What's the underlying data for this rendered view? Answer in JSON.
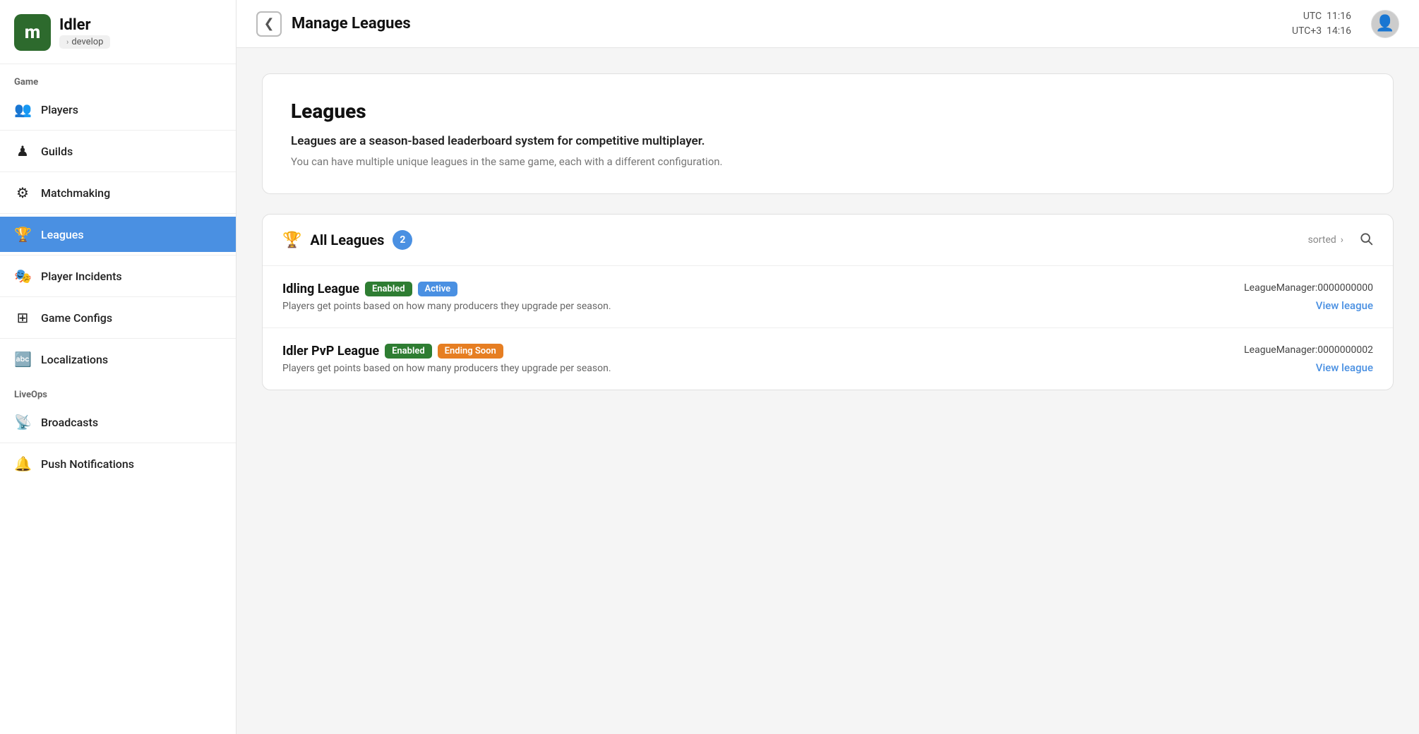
{
  "app": {
    "logo_letter": "m",
    "title": "Idler",
    "env": "develop"
  },
  "sidebar": {
    "game_label": "Game",
    "liveops_label": "LiveOps",
    "items_game": [
      {
        "id": "players",
        "label": "Players",
        "icon": "👥"
      },
      {
        "id": "guilds",
        "label": "Guilds",
        "icon": "♟"
      },
      {
        "id": "matchmaking",
        "label": "Matchmaking",
        "icon": "⚙"
      },
      {
        "id": "leagues",
        "label": "Leagues",
        "icon": "🏆",
        "active": true
      },
      {
        "id": "player-incidents",
        "label": "Player Incidents",
        "icon": "🎭"
      },
      {
        "id": "game-configs",
        "label": "Game Configs",
        "icon": "⊞"
      },
      {
        "id": "localizations",
        "label": "Localizations",
        "icon": "🔤"
      }
    ],
    "items_liveops": [
      {
        "id": "broadcasts",
        "label": "Broadcasts",
        "icon": "📡"
      },
      {
        "id": "push-notifications",
        "label": "Push Notifications",
        "icon": "🔔"
      }
    ]
  },
  "header": {
    "back_icon": "❮",
    "title": "Manage Leagues",
    "utc_label": "UTC",
    "utc_time": "11:16",
    "utcplus_label": "UTC+3",
    "utcplus_time": "14:16"
  },
  "info_card": {
    "title": "Leagues",
    "desc1": "Leagues are a season-based leaderboard system for competitive multiplayer.",
    "desc2": "You can have multiple unique leagues in the same game, each with a different configuration."
  },
  "leagues_section": {
    "icon": "🏆",
    "title": "All Leagues",
    "count": 2,
    "sorted_label": "sorted",
    "leagues": [
      {
        "name": "Idling League",
        "badges": [
          {
            "label": "Enabled",
            "color": "green"
          },
          {
            "label": "Active",
            "color": "blue"
          }
        ],
        "description": "Players get points based on how many producers they upgrade per season.",
        "manager": "LeagueManager:0000000000",
        "view_link": "View league"
      },
      {
        "name": "Idler PvP League",
        "badges": [
          {
            "label": "Enabled",
            "color": "green"
          },
          {
            "label": "Ending Soon",
            "color": "orange"
          }
        ],
        "description": "Players get points based on how many producers they upgrade per season.",
        "manager": "LeagueManager:0000000002",
        "view_link": "View league"
      }
    ]
  }
}
